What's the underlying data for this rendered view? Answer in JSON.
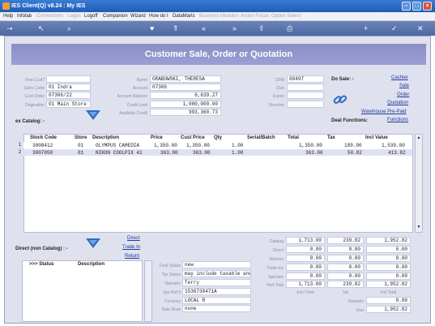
{
  "window": {
    "title": "IES Client(Q) v8.24 : My IES"
  },
  "menu": [
    {
      "label": "Help",
      "enabled": true
    },
    {
      "label": "Infolab",
      "enabled": true
    },
    {
      "label": "Connections",
      "enabled": false
    },
    {
      "label": "Logon",
      "enabled": false
    },
    {
      "label": "Logoff",
      "enabled": true
    },
    {
      "label": "Companion",
      "enabled": true
    },
    {
      "label": "Wizard",
      "enabled": true
    },
    {
      "label": "How do I",
      "enabled": true
    },
    {
      "label": "DataMarts",
      "enabled": true
    },
    {
      "label": "Business Modules",
      "enabled": false
    },
    {
      "label": "Action Focus",
      "enabled": false
    },
    {
      "label": "Option Select",
      "enabled": false
    }
  ],
  "toolbar": {
    "icons": [
      "key-icon",
      "cursor-icon",
      "search-icon",
      "heart-icon",
      "up-icon",
      "rewind-icon",
      "forward-icon",
      "upload-icon",
      "print-icon",
      "plus-icon",
      "check-icon",
      "close-icon"
    ]
  },
  "page": {
    "title": "Customer Sale, Order or Quotation"
  },
  "left": {
    "find_cust_label": "Find Cust?",
    "find_cust": "",
    "sales_code_label": "Sales Code",
    "sales_code": "01 Indra",
    "cust_order_label": "Cust Order",
    "cust_order": "07306/22",
    "origination_label": "Origination",
    "origination": "01 Main Store"
  },
  "middle": {
    "name_label": "Name",
    "name": "GRABOWSKI, THERESA",
    "account_label": "Account",
    "account": "07306",
    "balance_label": "Account Balance",
    "balance": "6,639.27",
    "limit_label": "Credit Limit",
    "limit": "1,000,000.00",
    "available_label": "Available Credit",
    "available": "993,360.73"
  },
  "right": {
    "crm_label": "CRM",
    "crm": "08497",
    "club_label": "Club",
    "club": "",
    "expiry_label": "Expiry",
    "expiry": "",
    "directive_label": "Directive",
    "directive": ""
  },
  "dosale": {
    "label": "Do Sale: -",
    "links": [
      "Cashier",
      "Sale",
      "Order",
      "Quotation",
      "Warehouse Pre-Paid"
    ],
    "functions_label": "Deal Functions:",
    "functions_link": "Functions"
  },
  "catalog": {
    "label": "ex Catalog: -",
    "columns": [
      "Stock Code",
      "Store",
      "Description",
      "Price",
      "Cust Price",
      "Qty",
      "Serial/Batch",
      "Total",
      "Tax",
      "Incl Value"
    ],
    "rows": [
      {
        "n": "1",
        "stock": "3008412",
        "store": "01",
        "desc": "OLYMPUS CAMEDIA",
        "price": "1,350.00",
        "cust_price": "1,350.00",
        "qty": "1.00",
        "serial": "",
        "total": "1,350.00",
        "tax": "189.00",
        "incl": "1,539.00"
      },
      {
        "n": "2",
        "stock": "3007058",
        "store": "01",
        "desc": "NIKON COOLPIX 41",
        "price": "363.00",
        "cust_price": "363.00",
        "qty": "1.00",
        "serial": "",
        "total": "363.00",
        "tax": "50.82",
        "incl": "413.82"
      }
    ]
  },
  "direct": {
    "label": "Direct (non Catalog) : -",
    "links": [
      "Direct",
      "Trade In",
      "Return"
    ],
    "columns": [
      ">>> Status",
      "Description"
    ]
  },
  "deal": {
    "status_label": "Deal Status",
    "status": "new",
    "tax_status_label": "Tax Status",
    "tax_status": "may include taxable and",
    "operator_label": "Operator",
    "operator": "Terry",
    "sys_ref_label": "Sys Ref #",
    "sys_ref": "1536738471A",
    "currency_label": "Currency",
    "currency": "LOCAL R",
    "rate_book_label": "Rate Book",
    "rate_book": "none"
  },
  "totals": {
    "rows": [
      {
        "label": "Catalog",
        "excl": "1,713.00",
        "tax": "239.82",
        "incl": "1,952.82"
      },
      {
        "label": "Direct",
        "excl": "0.00",
        "tax": "0.00",
        "incl": "0.00"
      },
      {
        "label": "Returns",
        "excl": "0.00",
        "tax": "0.00",
        "incl": "0.00"
      },
      {
        "label": "Trade-Ins",
        "excl": "0.00",
        "tax": "0.00",
        "incl": "0.00"
      },
      {
        "label": "Specials",
        "excl": "0.00",
        "tax": "0.00",
        "incl": "0.00"
      },
      {
        "label": "Nett Total",
        "excl": "1,713.00",
        "tax": "239.82",
        "incl": "1,952.82"
      }
    ],
    "excl_total_label": "Excl Total",
    "tax_label": "Tax",
    "incl_total_label": "Incl Total",
    "deposits_label": "Deposits",
    "deposits": "0.00",
    "due_label": "Due",
    "due": "1,952.82"
  }
}
